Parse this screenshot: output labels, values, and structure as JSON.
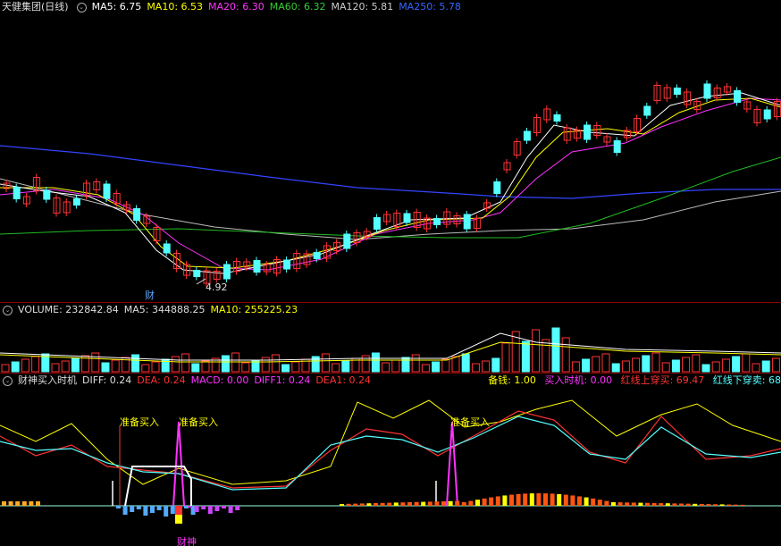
{
  "main": {
    "title": "天健集团(日线)",
    "ma": [
      {
        "label": "MA5: 6.75",
        "color": "#ffffff"
      },
      {
        "label": "MA10: 6.53",
        "color": "#ffff00"
      },
      {
        "label": "MA20: 6.30",
        "color": "#ff33ff"
      },
      {
        "label": "MA60: 6.32",
        "color": "#33cc33"
      },
      {
        "label": "MA120: 5.81",
        "color": "#cccccc"
      },
      {
        "label": "MA250: 5.78",
        "color": "#3366ff"
      }
    ],
    "low_label": "4.92",
    "cai_label": "财"
  },
  "volume": {
    "label": "VOLUME: 232842.84",
    "ma5": "MA5: 344888.25",
    "ma10": "MA10: 255225.23"
  },
  "indicator": {
    "name": "财神买入时机",
    "diff": "DIFF: 0.24",
    "dea": "DEA: 0.24",
    "macd": "MACD: 0.00",
    "diff1": "DIFF1: 0.24",
    "dea1": "DEA1: 0.24",
    "beiqian": "备钱: 1.00",
    "buy": "买入时机: 0.00",
    "red_up": "红线上穿买: 69.47",
    "red_down": "红线下穿卖: 68",
    "ready1": "准备买入",
    "ready2": "准备买入",
    "ready3": "准备买入",
    "caishen": "财神"
  },
  "colors": {
    "up": "#ff3333",
    "down": "#54ffff",
    "divider": "#8b0000"
  }
}
